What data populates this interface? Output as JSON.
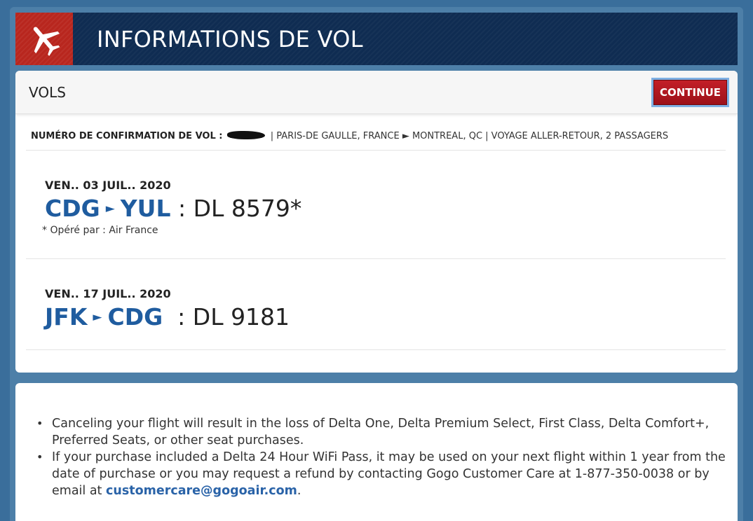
{
  "header": {
    "title": "INFORMATIONS DE VOL",
    "icon": "airplane-icon"
  },
  "flights_section": {
    "title": "VOLS",
    "continue_label": "CONTINUE",
    "confirmation_label": "NUMÉRO DE CONFIRMATION DE VOL :",
    "trip_summary": "| PARIS-DE GAULLE, FRANCE ► MONTREAL, QC | VOYAGE ALLER-RETOUR, 2 PASSAGERS",
    "flights": [
      {
        "date": "VEN.. 03 JUIL.. 2020",
        "from": "CDG",
        "to": "YUL",
        "flight_number": ": DL 8579*",
        "note": "* Opéré par : Air France"
      },
      {
        "date": "VEN.. 17 JUIL.. 2020",
        "from": "JFK",
        "to": "CDG",
        "flight_number": ": DL 9181",
        "note": ""
      }
    ]
  },
  "notices": {
    "items": [
      "Canceling your flight will result in the loss of Delta One, Delta Premium Select, First Class, Delta Comfort+, Preferred Seats, or other seat purchases.",
      "If your purchase included a Delta 24 Hour WiFi Pass, it may be used on your next flight within 1 year from the date of purchase or you may request a refund by contacting Gogo Customer Care at 1-877-350-0038 or by email at"
    ],
    "email": "customercare@gogoair.com",
    "email_suffix": "."
  },
  "colors": {
    "header_bg": "#0f2c52",
    "accent_red": "#b8261e",
    "link_blue": "#1f5c9f"
  }
}
